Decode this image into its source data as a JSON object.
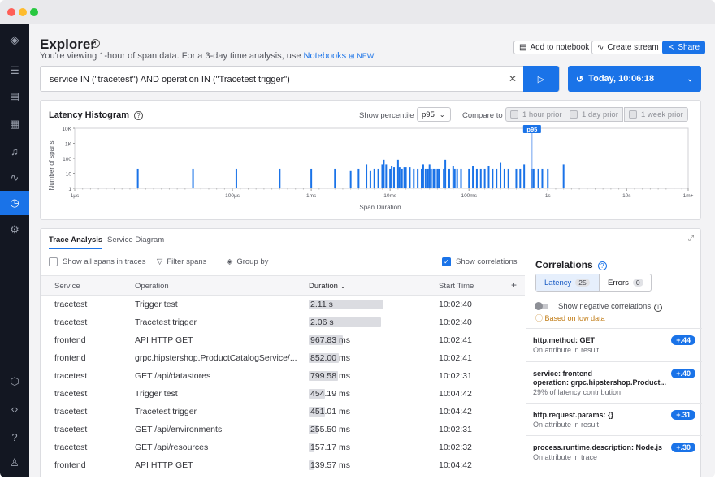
{
  "header": {
    "title": "Explorer",
    "subtitle_prefix": "You're viewing 1-hour of span data. For a 3-day time analysis, use ",
    "subtitle_link": "Notebooks",
    "subtitle_badge": "NEW"
  },
  "actions": {
    "add_notebook": "Add to notebook",
    "create_stream": "Create stream",
    "share": "Share"
  },
  "query": {
    "value": "service IN (\"tracetest\") AND operation IN (\"Tracetest trigger\")",
    "time_label": "Today, 10:06:18"
  },
  "histogram": {
    "title": "Latency Histogram",
    "percentile_label": "Show percentile",
    "percentile_value": "p95",
    "compare_label": "Compare to",
    "compare_options": [
      "1 hour prior",
      "1 day prior",
      "1 week prior"
    ]
  },
  "chart_data": {
    "type": "bar",
    "ylabel": "Number of spans",
    "xlabel": "Span Duration",
    "y_ticks": [
      "10K",
      "1K",
      "100",
      "10",
      "1"
    ],
    "x_ticks": [
      "1µs",
      "100µs",
      "1ms",
      "10ms",
      "100ms",
      "1s",
      "10s",
      "1m+"
    ],
    "marker_label": "p95",
    "x_log_min": 0,
    "x_log_max": 7.78,
    "marker_x": 5.8,
    "bars": [
      [
        0.8,
        1.3
      ],
      [
        1.5,
        1.3
      ],
      [
        2.05,
        1.3
      ],
      [
        2.6,
        1.3
      ],
      [
        3.0,
        1.3
      ],
      [
        3.3,
        1.3
      ],
      [
        3.5,
        1.2
      ],
      [
        3.6,
        1.3
      ],
      [
        3.7,
        1.6
      ],
      [
        3.75,
        1.2
      ],
      [
        3.8,
        1.3
      ],
      [
        3.85,
        1.3
      ],
      [
        3.9,
        1.6
      ],
      [
        3.92,
        1.9
      ],
      [
        3.95,
        1.6
      ],
      [
        4.0,
        1.3
      ],
      [
        4.02,
        1.5
      ],
      [
        4.05,
        1.4
      ],
      [
        4.1,
        1.9
      ],
      [
        4.12,
        1.4
      ],
      [
        4.15,
        1.3
      ],
      [
        4.18,
        1.4
      ],
      [
        4.2,
        1.4
      ],
      [
        4.25,
        1.4
      ],
      [
        4.3,
        1.3
      ],
      [
        4.35,
        1.3
      ],
      [
        4.4,
        1.3
      ],
      [
        4.42,
        1.6
      ],
      [
        4.45,
        1.3
      ],
      [
        4.48,
        1.3
      ],
      [
        4.5,
        1.6
      ],
      [
        4.52,
        1.3
      ],
      [
        4.55,
        1.3
      ],
      [
        4.57,
        1.3
      ],
      [
        4.6,
        1.3
      ],
      [
        4.62,
        1.3
      ],
      [
        4.68,
        1.3
      ],
      [
        4.7,
        1.9
      ],
      [
        4.75,
        1.3
      ],
      [
        4.8,
        1.5
      ],
      [
        4.82,
        1.3
      ],
      [
        4.85,
        1.3
      ],
      [
        4.9,
        1.3
      ],
      [
        5.0,
        1.3
      ],
      [
        5.05,
        1.5
      ],
      [
        5.1,
        1.3
      ],
      [
        5.15,
        1.3
      ],
      [
        5.2,
        1.3
      ],
      [
        5.25,
        1.5
      ],
      [
        5.3,
        1.3
      ],
      [
        5.35,
        1.3
      ],
      [
        5.4,
        1.7
      ],
      [
        5.45,
        1.3
      ],
      [
        5.5,
        1.3
      ],
      [
        5.6,
        1.3
      ],
      [
        5.65,
        1.3
      ],
      [
        5.7,
        1.6
      ],
      [
        5.8,
        1.3
      ],
      [
        5.82,
        1.3
      ],
      [
        5.88,
        1.3
      ],
      [
        5.93,
        1.3
      ],
      [
        6.0,
        1.3
      ],
      [
        6.2,
        1.6
      ]
    ]
  },
  "tabs": [
    "Trace Analysis",
    "Service Diagram"
  ],
  "toolbar": {
    "show_all": "Show all spans in traces",
    "filter": "Filter spans",
    "group": "Group by",
    "correlations": "Show correlations"
  },
  "table": {
    "columns": [
      "Service",
      "Operation",
      "Duration",
      "Start Time"
    ],
    "rows": [
      {
        "service": "tracetest",
        "operation": "Trigger test",
        "duration": "2.11 s",
        "fill": 0.95,
        "start": "10:02:40"
      },
      {
        "service": "tracetest",
        "operation": "Tracetest trigger",
        "duration": "2.06 s",
        "fill": 0.93,
        "start": "10:02:40"
      },
      {
        "service": "frontend",
        "operation": "API HTTP GET",
        "duration": "967.83 ms",
        "fill": 0.44,
        "start": "10:02:41"
      },
      {
        "service": "frontend",
        "operation": "grpc.hipstershop.ProductCatalogService/...",
        "duration": "852.00 ms",
        "fill": 0.39,
        "start": "10:02:41"
      },
      {
        "service": "tracetest",
        "operation": "GET /api/datastores",
        "duration": "799.58 ms",
        "fill": 0.37,
        "start": "10:02:31"
      },
      {
        "service": "tracetest",
        "operation": "Trigger test",
        "duration": "454.19 ms",
        "fill": 0.21,
        "start": "10:04:42"
      },
      {
        "service": "tracetest",
        "operation": "Tracetest trigger",
        "duration": "451.01 ms",
        "fill": 0.21,
        "start": "10:04:42"
      },
      {
        "service": "tracetest",
        "operation": "GET /api/environments",
        "duration": "255.50 ms",
        "fill": 0.12,
        "start": "10:02:31"
      },
      {
        "service": "tracetest",
        "operation": "GET /api/resources",
        "duration": "157.17 ms",
        "fill": 0.07,
        "start": "10:02:32"
      },
      {
        "service": "frontend",
        "operation": "API HTTP GET",
        "duration": "139.57 ms",
        "fill": 0.06,
        "start": "10:04:42"
      }
    ]
  },
  "correlations": {
    "title": "Correlations",
    "latency_label": "Latency",
    "latency_count": "25",
    "errors_label": "Errors",
    "errors_count": "0",
    "negative": "Show negative correlations",
    "low_data": "Based on low data",
    "items": [
      {
        "key": "http.method: GET",
        "key2": "",
        "sub": "On attribute in result",
        "score": "+.44"
      },
      {
        "key": "service: frontend",
        "key2": "operation: grpc.hipstershop.Product...",
        "sub": "29% of latency contribution",
        "score": "+.40"
      },
      {
        "key": "http.request.params: {}",
        "key2": "",
        "sub": "On attribute in result",
        "score": "+.31"
      },
      {
        "key": "process.runtime.description: Node.js",
        "key2": "",
        "sub": "On attribute in trace",
        "score": "+.30"
      }
    ]
  }
}
